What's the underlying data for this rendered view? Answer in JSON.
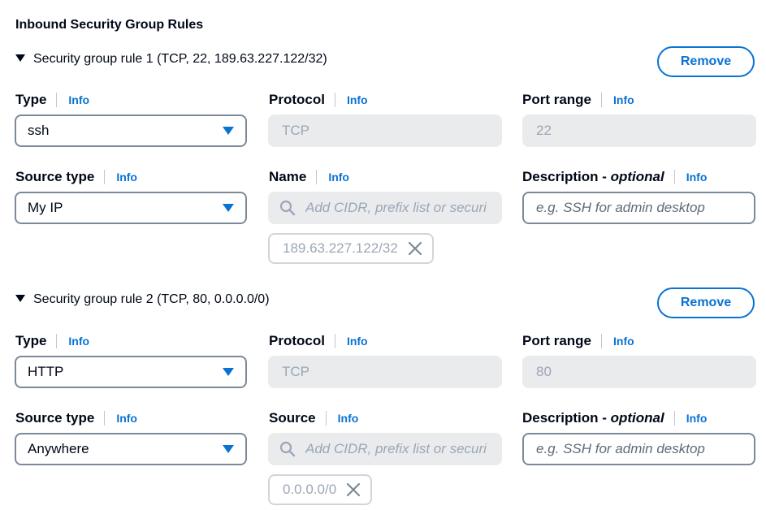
{
  "section_title": "Inbound Security Group Rules",
  "rules": [
    {
      "header": "Security group rule 1 (TCP, 22, 189.63.227.122/32)",
      "remove_label": "Remove",
      "type_label": "Type",
      "type_value": "ssh",
      "protocol_label": "Protocol",
      "protocol_value": "TCP",
      "port_label": "Port range",
      "port_value": "22",
      "source_type_label": "Source type",
      "source_type_value": "My IP",
      "source_label": "Name",
      "source_placeholder": "Add CIDR, prefix list or securi",
      "source_token": "189.63.227.122/32",
      "desc_label": "Description - ",
      "desc_optional": "optional",
      "desc_placeholder": "e.g. SSH for admin desktop"
    },
    {
      "header": "Security group rule 2 (TCP, 80, 0.0.0.0/0)",
      "remove_label": "Remove",
      "type_label": "Type",
      "type_value": "HTTP",
      "protocol_label": "Protocol",
      "protocol_value": "TCP",
      "port_label": "Port range",
      "port_value": "80",
      "source_type_label": "Source type",
      "source_type_value": "Anywhere",
      "source_label": "Source",
      "source_placeholder": "Add CIDR, prefix list or securi",
      "source_token": "0.0.0.0/0",
      "desc_label": "Description - ",
      "desc_optional": "optional",
      "desc_placeholder": "e.g. SSH for admin desktop"
    }
  ],
  "info_label": "Info",
  "colors": {
    "accent": "#0972d3",
    "text": "#000716",
    "disabled_bg": "#e9ebed",
    "disabled_text": "#9ba7b6",
    "border": "#7d8998"
  },
  "icons": [
    "caret-down-icon",
    "dropdown-triangle-icon",
    "search-icon",
    "close-icon"
  ]
}
